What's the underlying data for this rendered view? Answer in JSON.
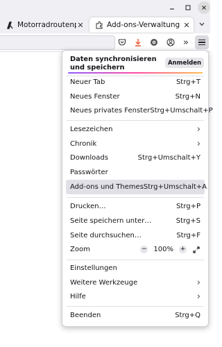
{
  "window": {
    "controls": {
      "minimize_icon": "minimize-icon",
      "maximize_icon": "maximize-icon",
      "close_icon": "close-icon"
    }
  },
  "tabs": [
    {
      "label": "Motorradroutenplan",
      "icon": "route-logo-icon",
      "active": false
    },
    {
      "label": "Add-ons-Verwaltung",
      "icon": "puzzle-icon",
      "active": true
    }
  ],
  "toolbar": {
    "icons": [
      "pocket-icon",
      "download-icon",
      "extensions-icon",
      "account-icon",
      "overflow-icon",
      "menu-icon"
    ],
    "download_accent": "#e8562e"
  },
  "menu": {
    "sync": {
      "text": "Daten synchronisieren und speichern",
      "button": "Anmelden"
    },
    "items": [
      {
        "label": "Neuer Tab",
        "shortcut": "Strg+T"
      },
      {
        "label": "Neues Fenster",
        "shortcut": "Strg+N"
      },
      {
        "label": "Neues privates Fenster",
        "shortcut": "Strg+Umschalt+P"
      },
      {
        "label": "Lesezeichen",
        "shortcut": ""
      },
      {
        "label": "Chronik",
        "shortcut": ""
      },
      {
        "label": "Downloads",
        "shortcut": "Strg+Umschalt+Y"
      },
      {
        "label": "Passwörter",
        "shortcut": ""
      },
      {
        "label": "Add-ons und Themes",
        "shortcut": "Strg+Umschalt+A",
        "highlighted": true
      },
      {
        "label": "Drucken…",
        "shortcut": "Strg+P"
      },
      {
        "label": "Seite speichern unter…",
        "shortcut": "Strg+S"
      },
      {
        "label": "Seite durchsuchen…",
        "shortcut": "Strg+F"
      },
      {
        "label": "Einstellungen",
        "shortcut": ""
      },
      {
        "label": "Weitere Werkzeuge",
        "shortcut": ""
      },
      {
        "label": "Hilfe",
        "shortcut": ""
      },
      {
        "label": "Beenden",
        "shortcut": "Strg+Q"
      }
    ],
    "zoom": {
      "label": "Zoom",
      "value": "100%",
      "minus": "−",
      "plus": "+"
    }
  }
}
